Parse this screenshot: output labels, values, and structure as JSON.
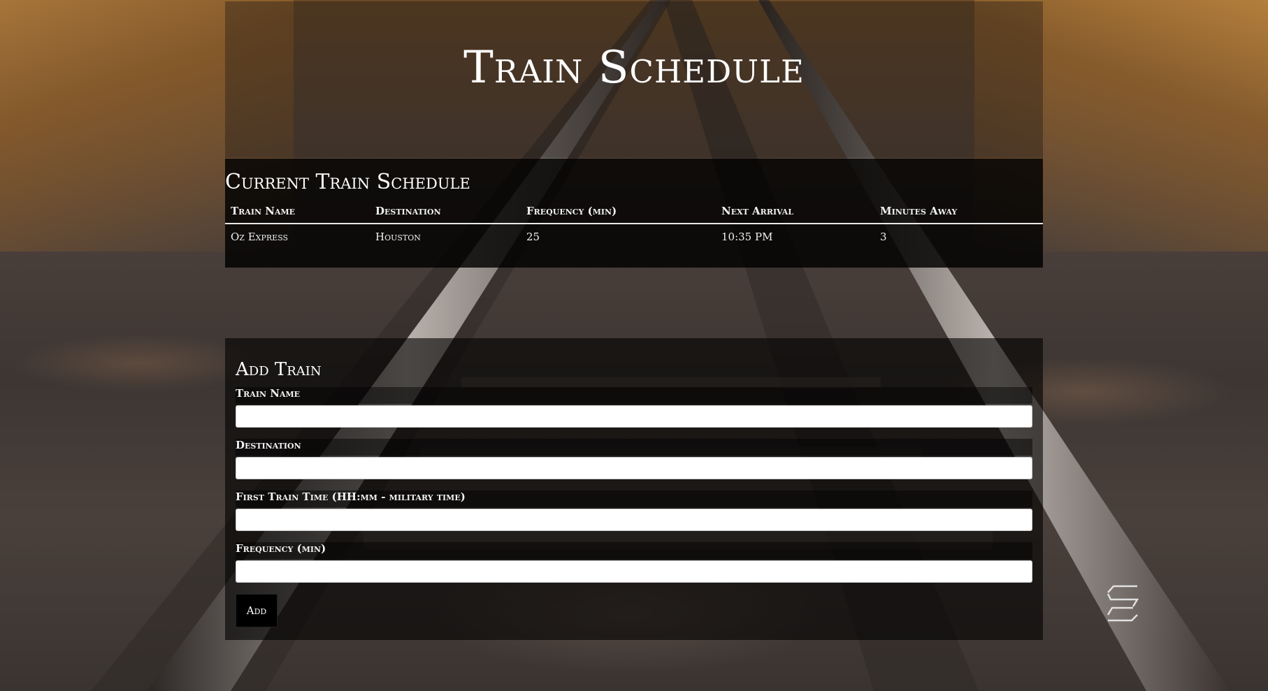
{
  "page": {
    "title": "Train Schedule"
  },
  "schedule": {
    "heading": "Current Train Schedule",
    "columns": [
      "Train Name",
      "Destination",
      "Frequency (min)",
      "Next Arrival",
      "Minutes Away"
    ],
    "rows": [
      [
        "Oz Express",
        "Houston",
        "25",
        "10:35 PM",
        "3"
      ]
    ]
  },
  "form": {
    "heading": "Add Train",
    "fields": [
      {
        "label": "Train Name",
        "value": ""
      },
      {
        "label": "Destination",
        "value": ""
      },
      {
        "label": "First Train Time (HH:mm - military time)",
        "value": ""
      },
      {
        "label": "Frequency (min)",
        "value": ""
      }
    ],
    "submit_label": "Add"
  },
  "logo": {
    "icon": "stacked-s-logo-icon"
  }
}
